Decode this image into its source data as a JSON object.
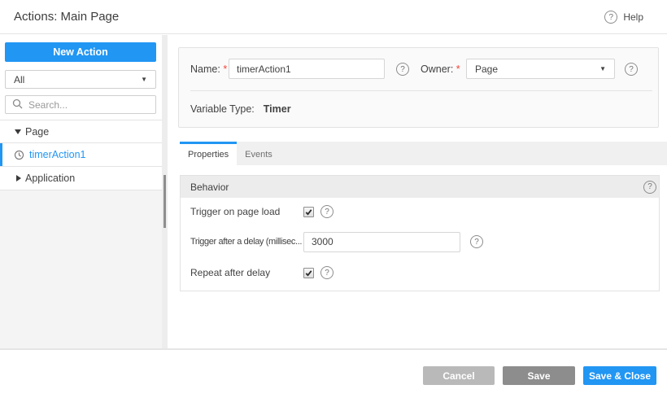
{
  "header": {
    "title": "Actions: Main Page",
    "help_label": "Help"
  },
  "sidebar": {
    "new_action_label": "New Action",
    "filter_value": "All",
    "search_placeholder": "Search...",
    "tree": [
      {
        "label": "Page",
        "type": "group",
        "state": "expanded"
      },
      {
        "label": "timerAction1",
        "type": "timer-action",
        "selected": true
      },
      {
        "label": "Application",
        "type": "group",
        "state": "collapsed"
      }
    ]
  },
  "form": {
    "name_label": "Name:",
    "required_marker": "*",
    "name_value": "timerAction1",
    "owner_label": "Owner:",
    "owner_value": "Page",
    "variable_type_label": "Variable Type:",
    "variable_type_value": "Timer"
  },
  "tabs": [
    {
      "label": "Properties",
      "active": true
    },
    {
      "label": "Events",
      "active": false
    }
  ],
  "behavior": {
    "title": "Behavior",
    "rows": [
      {
        "label": "Trigger on page load",
        "control": "checkbox",
        "checked": true
      },
      {
        "label": "Trigger after a delay (millisec...",
        "control": "input",
        "value": "3000"
      },
      {
        "label": "Repeat after delay",
        "control": "checkbox",
        "checked": true
      }
    ]
  },
  "footer": {
    "cancel_label": "Cancel",
    "save_label": "Save",
    "save_close_label": "Save & Close"
  },
  "colors": {
    "accent": "#2196f3",
    "cancel_bg": "#b9b9b9",
    "save_bg": "#8d8d8d",
    "selected_text": "#2196f3"
  }
}
